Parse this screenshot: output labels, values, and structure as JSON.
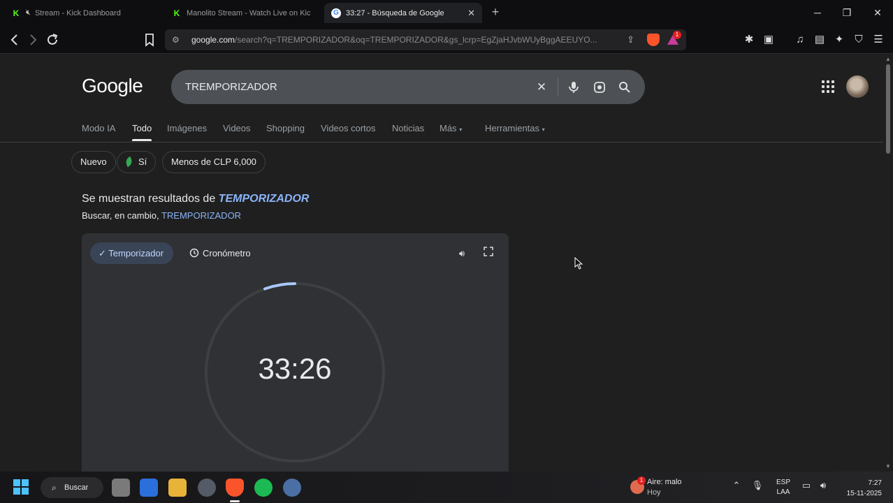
{
  "browser": {
    "tabs": [
      {
        "title": "Stream - Kick Dashboard",
        "favicon": "kick-icon",
        "active": false
      },
      {
        "title": "Manolito Stream - Watch Live on Kic",
        "favicon": "kick-icon",
        "active": false
      },
      {
        "title": "33:27 - Búsqueda de Google",
        "favicon": "google-icon",
        "active": true
      }
    ],
    "new_tab_label": "+",
    "url_host": "google.com",
    "url_rest": "/search?q=TREMPORIZADOR&oq=TREMPORIZADOR&gs_lcrp=EgZjaHJvbWUyBggAEEUYO...",
    "rewards_badge": "1"
  },
  "google": {
    "logo": "Google",
    "query": "TREMPORIZADOR",
    "nav_tabs": [
      {
        "label": "Modo IA",
        "active": false
      },
      {
        "label": "Todo",
        "active": true
      },
      {
        "label": "Imágenes",
        "active": false
      },
      {
        "label": "Videos",
        "active": false
      },
      {
        "label": "Shopping",
        "active": false
      },
      {
        "label": "Videos cortos",
        "active": false
      },
      {
        "label": "Noticias",
        "active": false
      },
      {
        "label": "Más",
        "active": false
      },
      {
        "label": "Herramientas",
        "active": false
      }
    ],
    "chips": [
      "Nuevo",
      "Sí",
      "Menos de CLP 6,000"
    ],
    "showing_prefix": "Se muestran resultados de",
    "corrected_query": "TEMPORIZADOR",
    "instead_prefix": "Buscar, en cambio,",
    "original_query": "TREMPORIZADOR"
  },
  "timer": {
    "tab_timer": "Temporizador",
    "tab_stopwatch": "Cronómetro",
    "time": "33:26",
    "progress_fraction": 0.055,
    "ring_color": "#a8c7fa",
    "track_color": "#3c4043"
  },
  "taskbar": {
    "search_label": "Buscar",
    "weather_line1": "Aire: malo",
    "weather_line2": "Hoy",
    "weather_badge": "1",
    "lang_line1": "ESP",
    "lang_line2": "LAA",
    "time": "7:27",
    "date": "15-11-2025"
  }
}
